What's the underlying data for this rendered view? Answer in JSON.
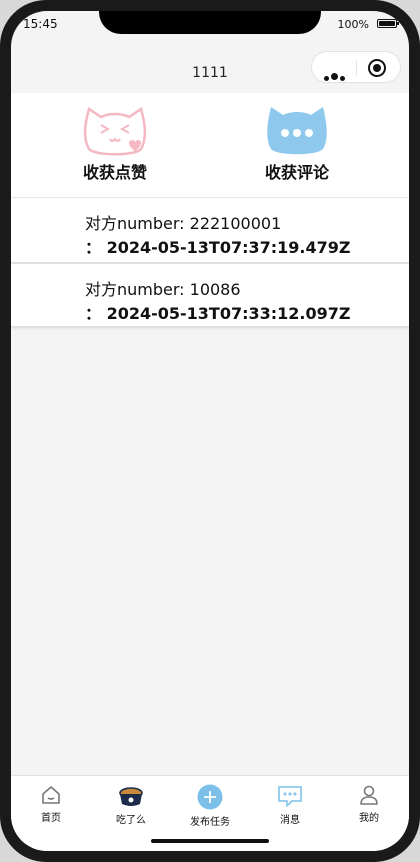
{
  "status_bar": {
    "time": "15:45",
    "battery": "100%"
  },
  "nav": {
    "title": "1111"
  },
  "header": {
    "likes_label": "收获点赞",
    "comments_label": "收获评论"
  },
  "records": [
    {
      "line1": "对方number: 222100001",
      "line2": "： 2024-05-13T07:37:19.479Z"
    },
    {
      "line1": "对方number: 10086",
      "line2": "： 2024-05-13T07:33:12.097Z"
    }
  ],
  "tabbar": {
    "items": [
      {
        "label": "首页",
        "icon": "home-icon"
      },
      {
        "label": "吃了么",
        "icon": "food-bowl-icon"
      },
      {
        "label": "发布任务",
        "icon": "plus-circle-icon"
      },
      {
        "label": "消息",
        "icon": "chat-bubble-icon"
      },
      {
        "label": "我的",
        "icon": "user-icon"
      }
    ]
  },
  "colors": {
    "accent_blue": "#8ec8ec",
    "pink": "#f4b8c2",
    "text": "#111111"
  }
}
